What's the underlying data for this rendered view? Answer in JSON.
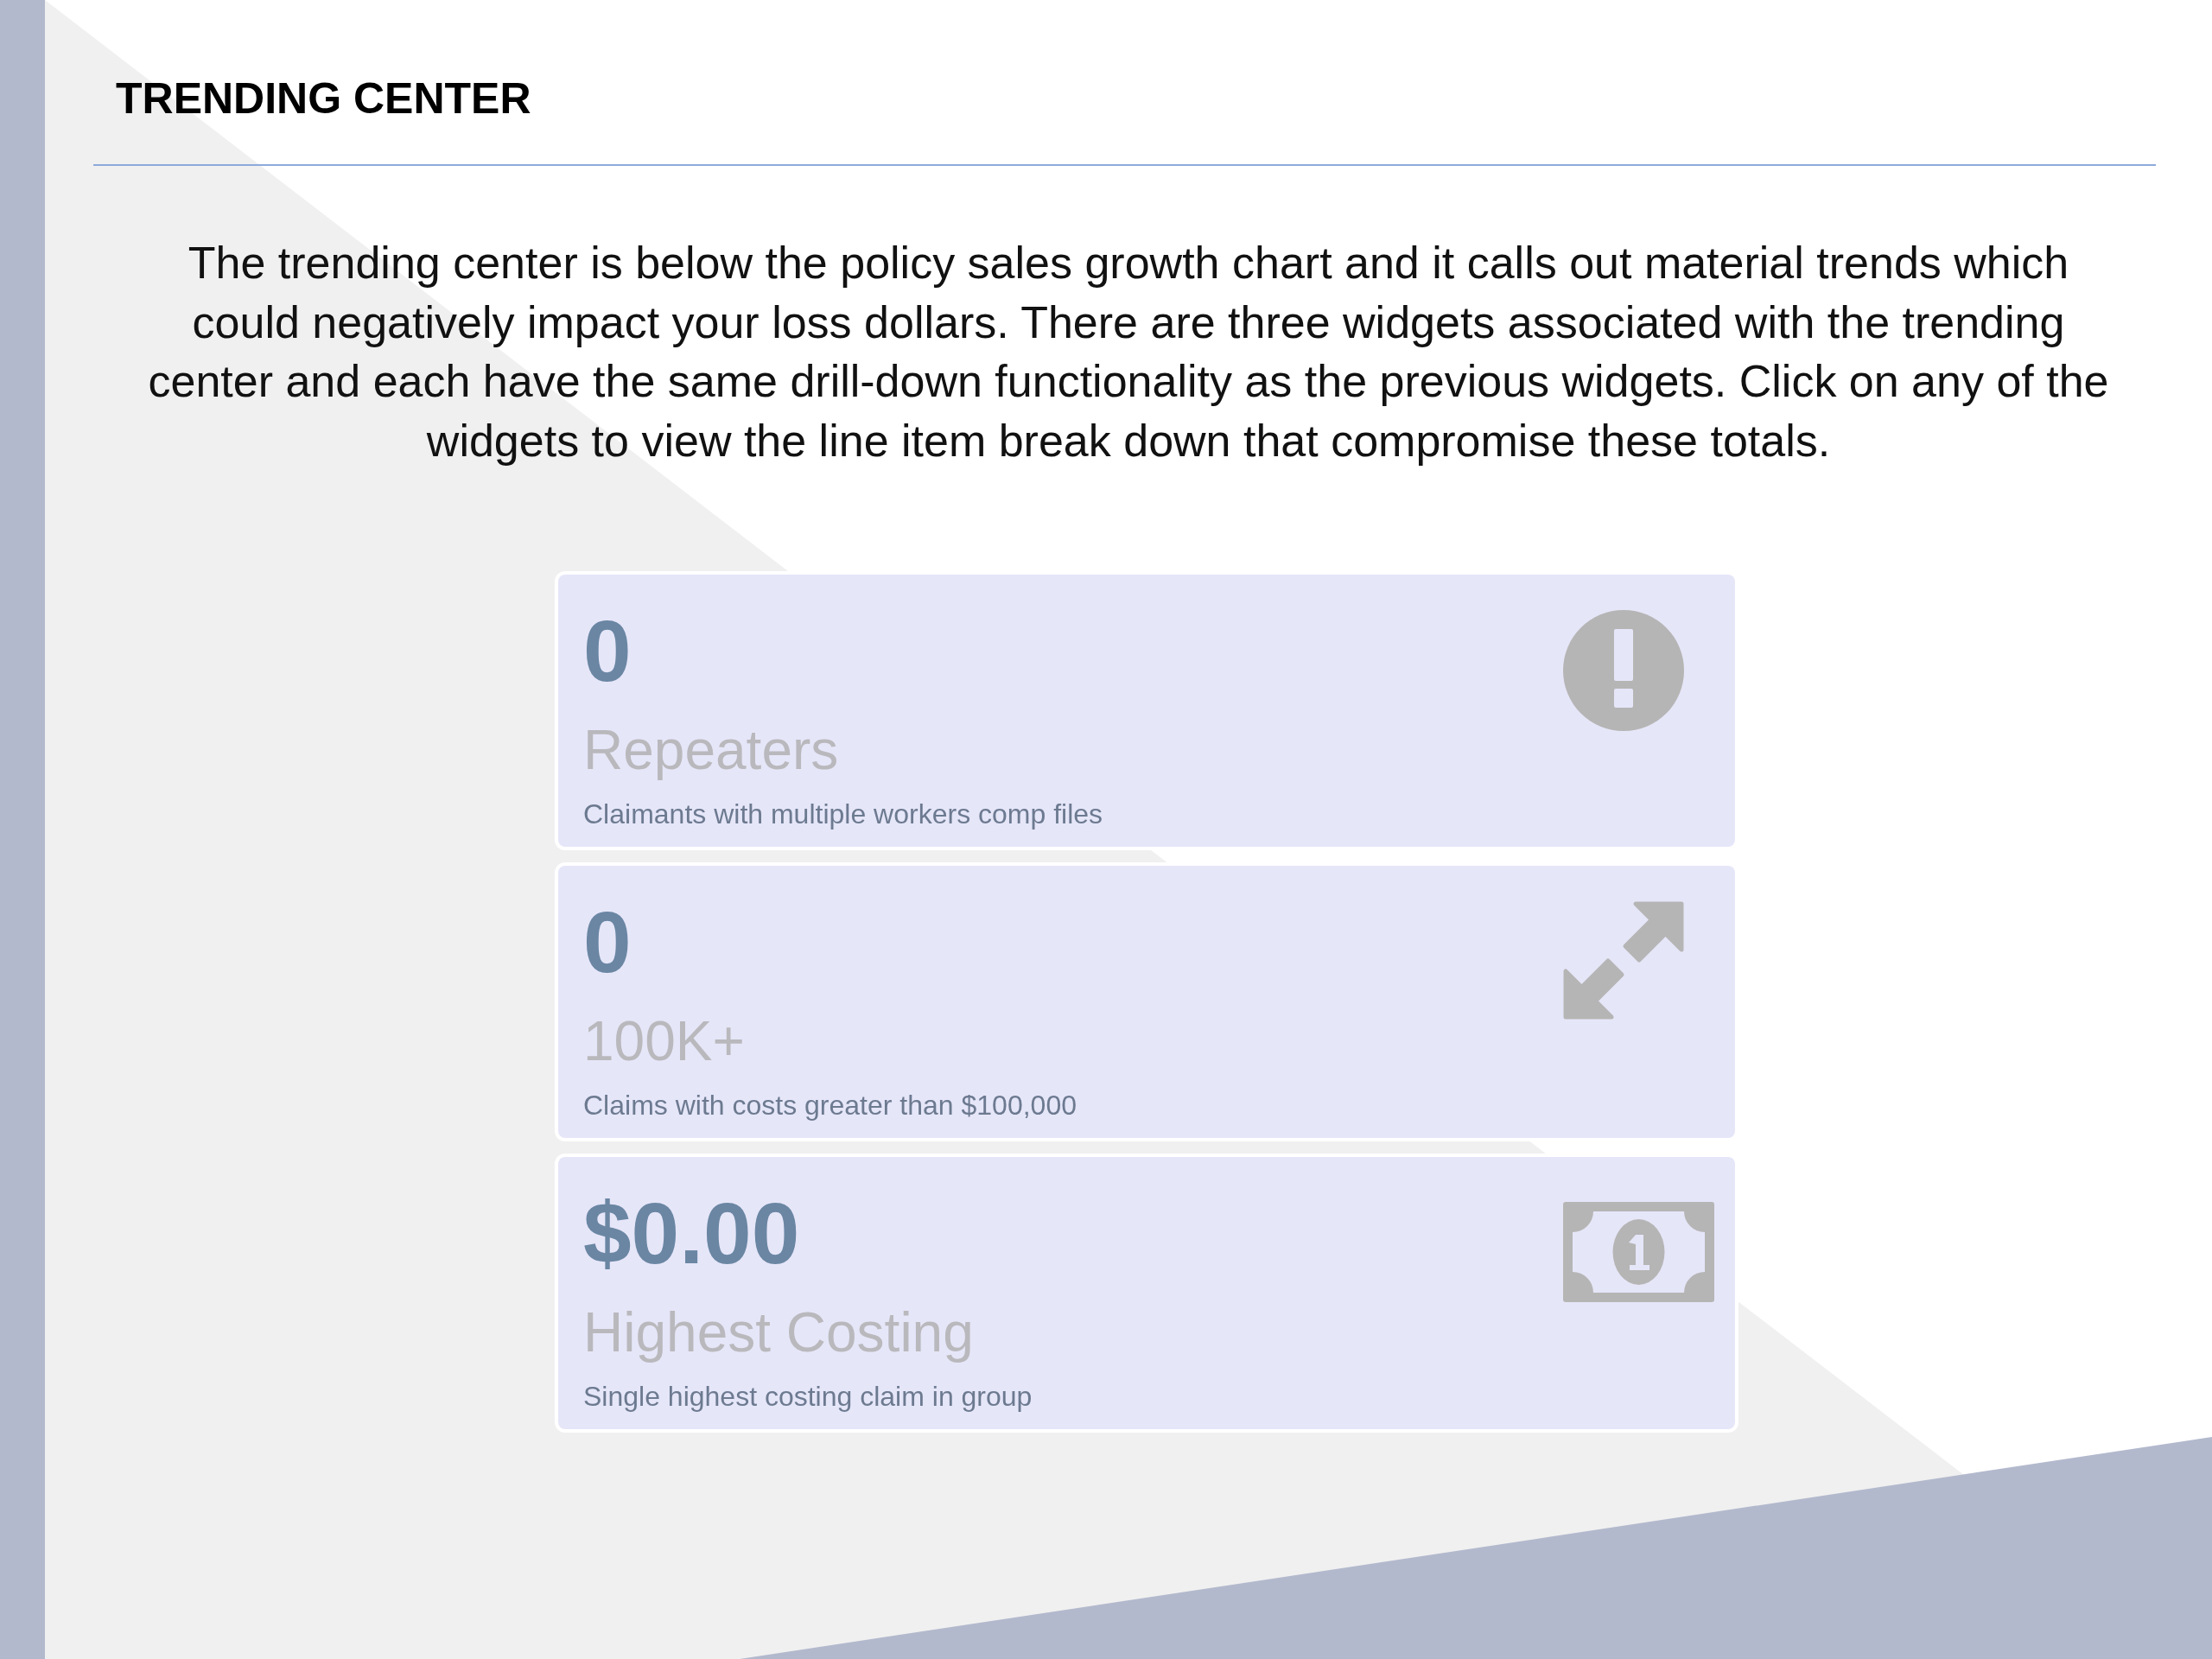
{
  "slide": {
    "title": "TRENDING CENTER",
    "body": "The trending center is below the policy sales growth chart and it calls out material trends which could negatively impact your loss dollars. There are three widgets associated with the trending center and each have the same drill-down functionality as the previous widgets. Click on any of the widgets to view the line item break down that compromise these totals."
  },
  "widgets": [
    {
      "kind": "alert",
      "value": "0",
      "label": "Repeaters",
      "description": "Claimants with multiple workers comp files"
    },
    {
      "kind": "expand",
      "value": "0",
      "label": "100K+",
      "description": "Claims with costs greater than $100,000"
    },
    {
      "kind": "money",
      "value": "$0.00",
      "label": "Highest Costing",
      "description": "Single highest costing claim in group"
    }
  ]
}
